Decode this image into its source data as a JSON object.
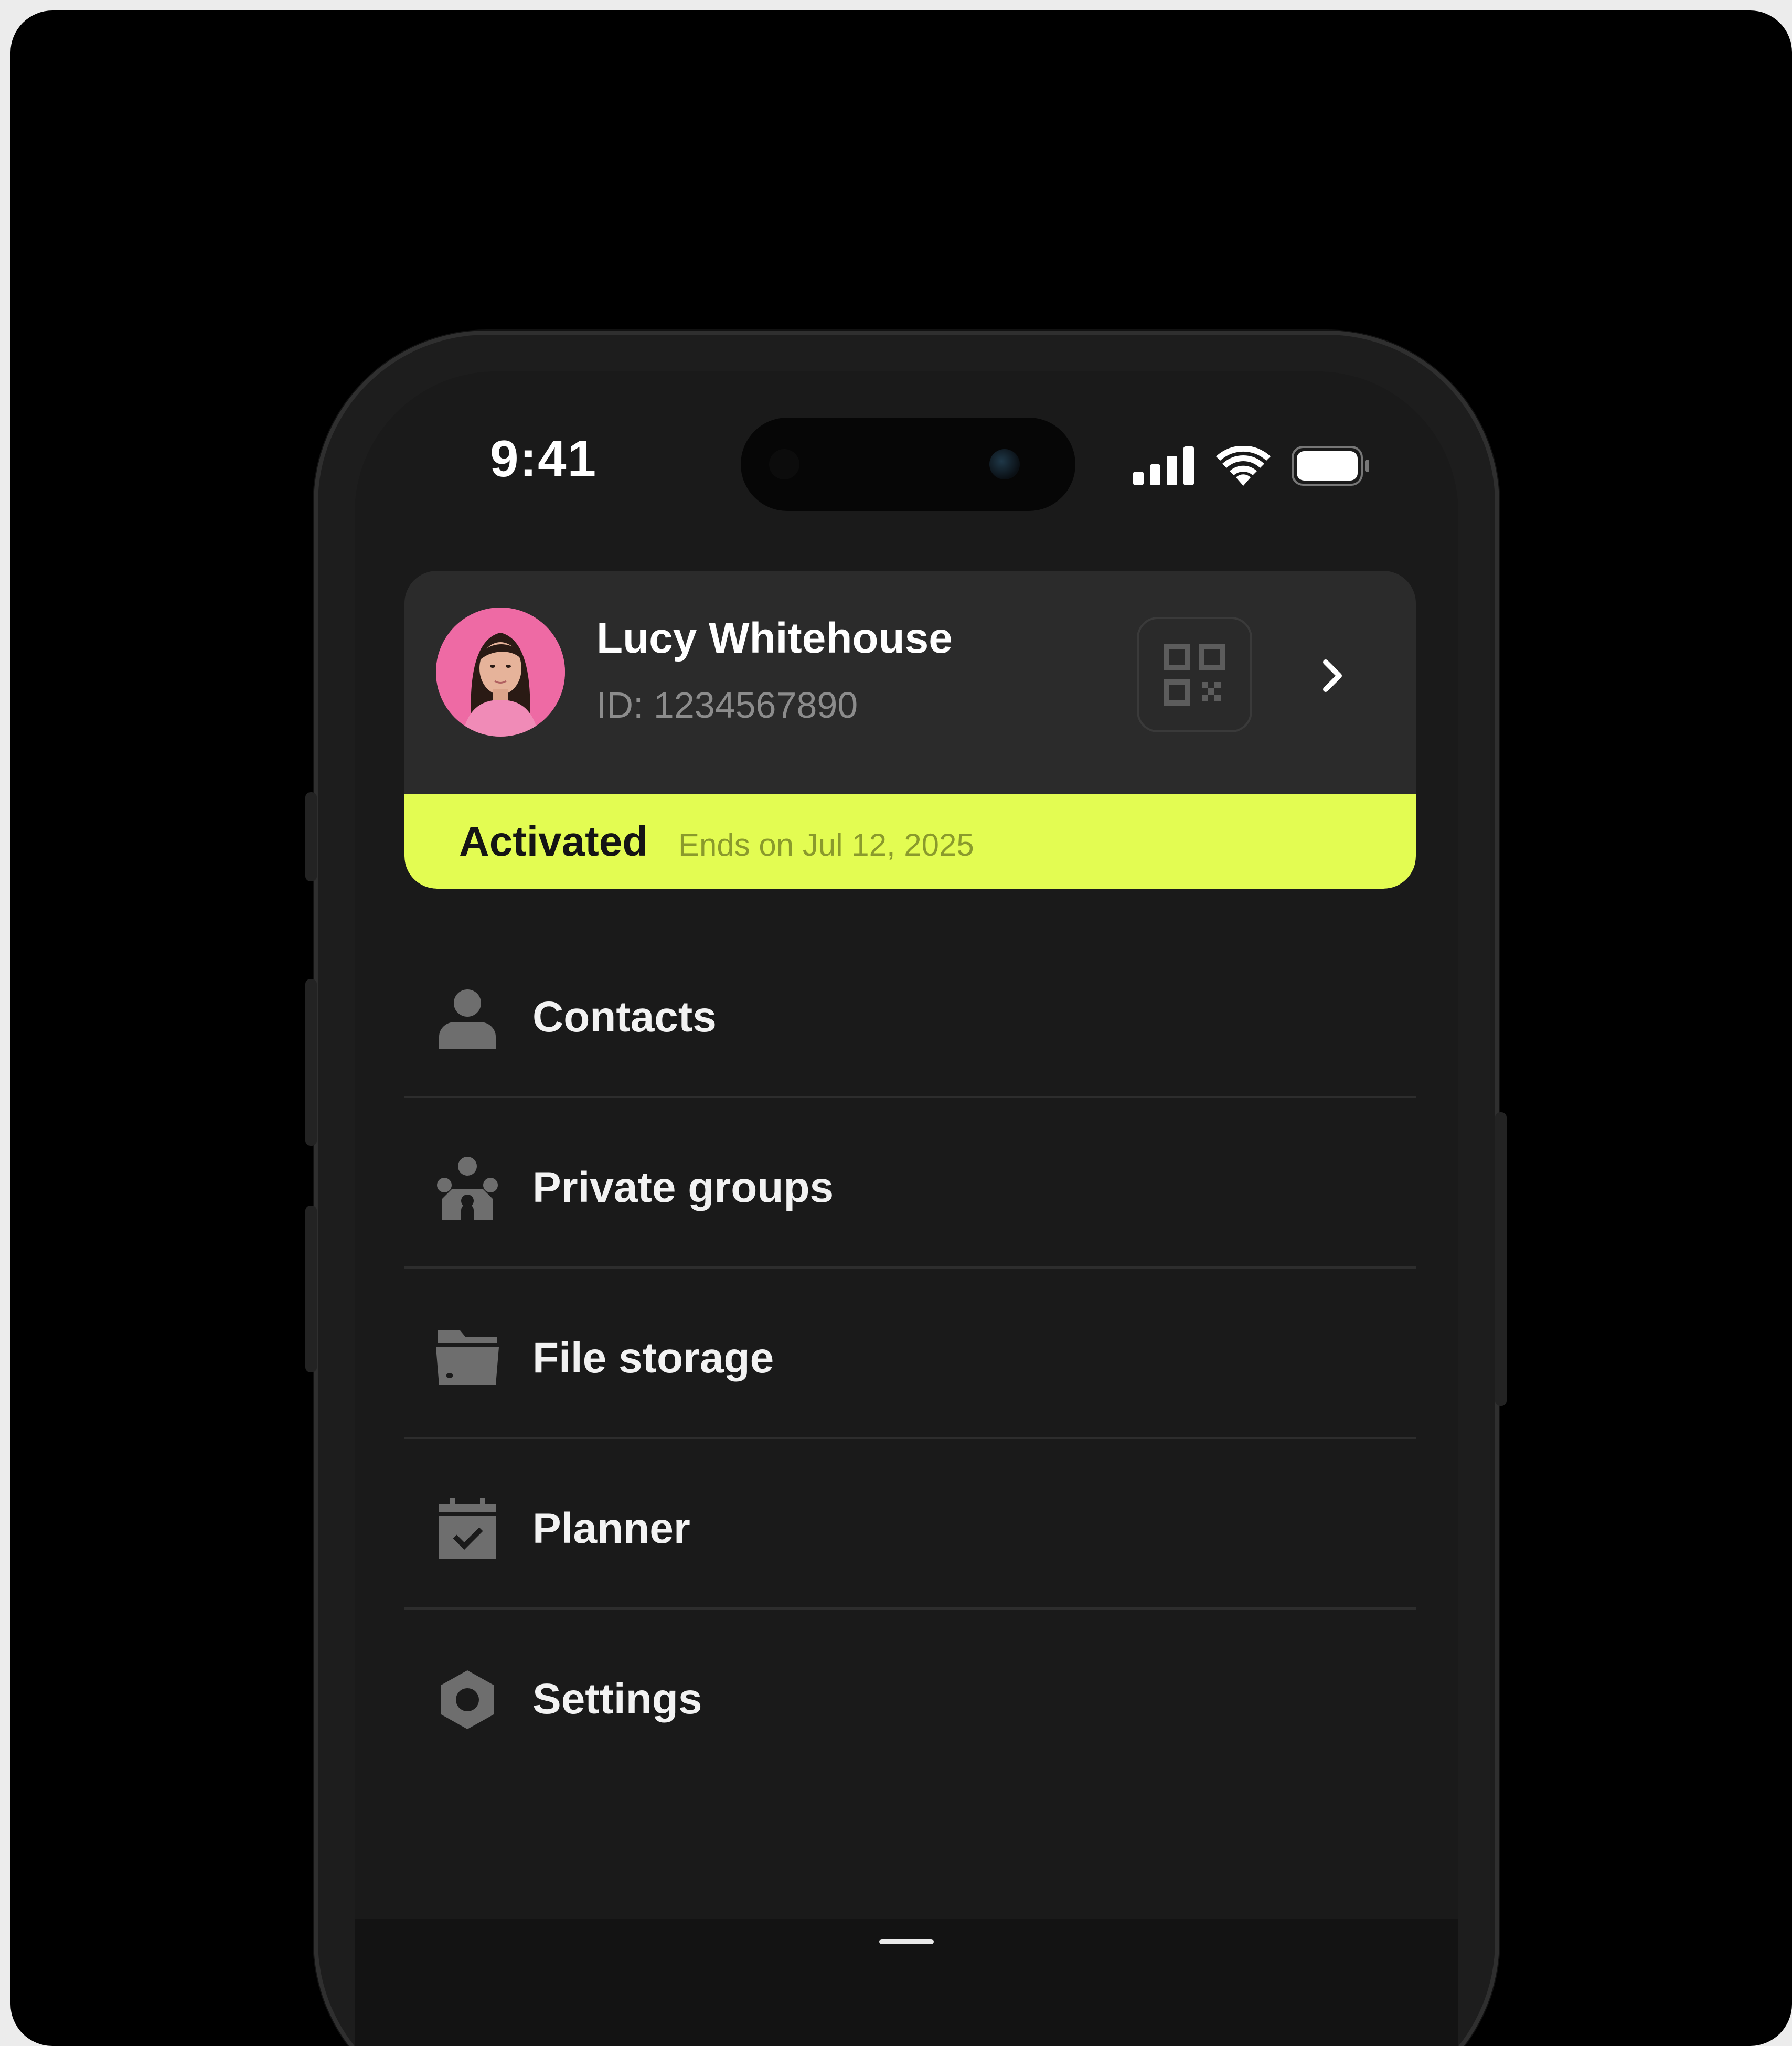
{
  "status_bar": {
    "time": "9:41",
    "icons": [
      "cellular-signal-icon",
      "wifi-icon",
      "battery-icon"
    ]
  },
  "profile": {
    "name": "Lucy Whitehouse",
    "id_label": "ID: 1234567890",
    "avatar": "avatar-photo",
    "qr_icon": "qr-code-icon",
    "chevron_icon": "chevron-right-icon"
  },
  "subscription": {
    "status": "Activated",
    "detail": "Ends on Jul 12, 2025"
  },
  "menu": {
    "items": [
      {
        "label": "Contacts",
        "icon": "person-icon"
      },
      {
        "label": "Private groups",
        "icon": "group-icon"
      },
      {
        "label": "File storage",
        "icon": "folder-icon"
      },
      {
        "label": "Planner",
        "icon": "calendar-check-icon"
      },
      {
        "label": "Settings",
        "icon": "hexagon-settings-icon"
      }
    ]
  },
  "colors": {
    "accent": "#e3fc52",
    "card": "#2b2b2b",
    "screen": "#1a1a1a",
    "icon": "#6e6e6e"
  }
}
